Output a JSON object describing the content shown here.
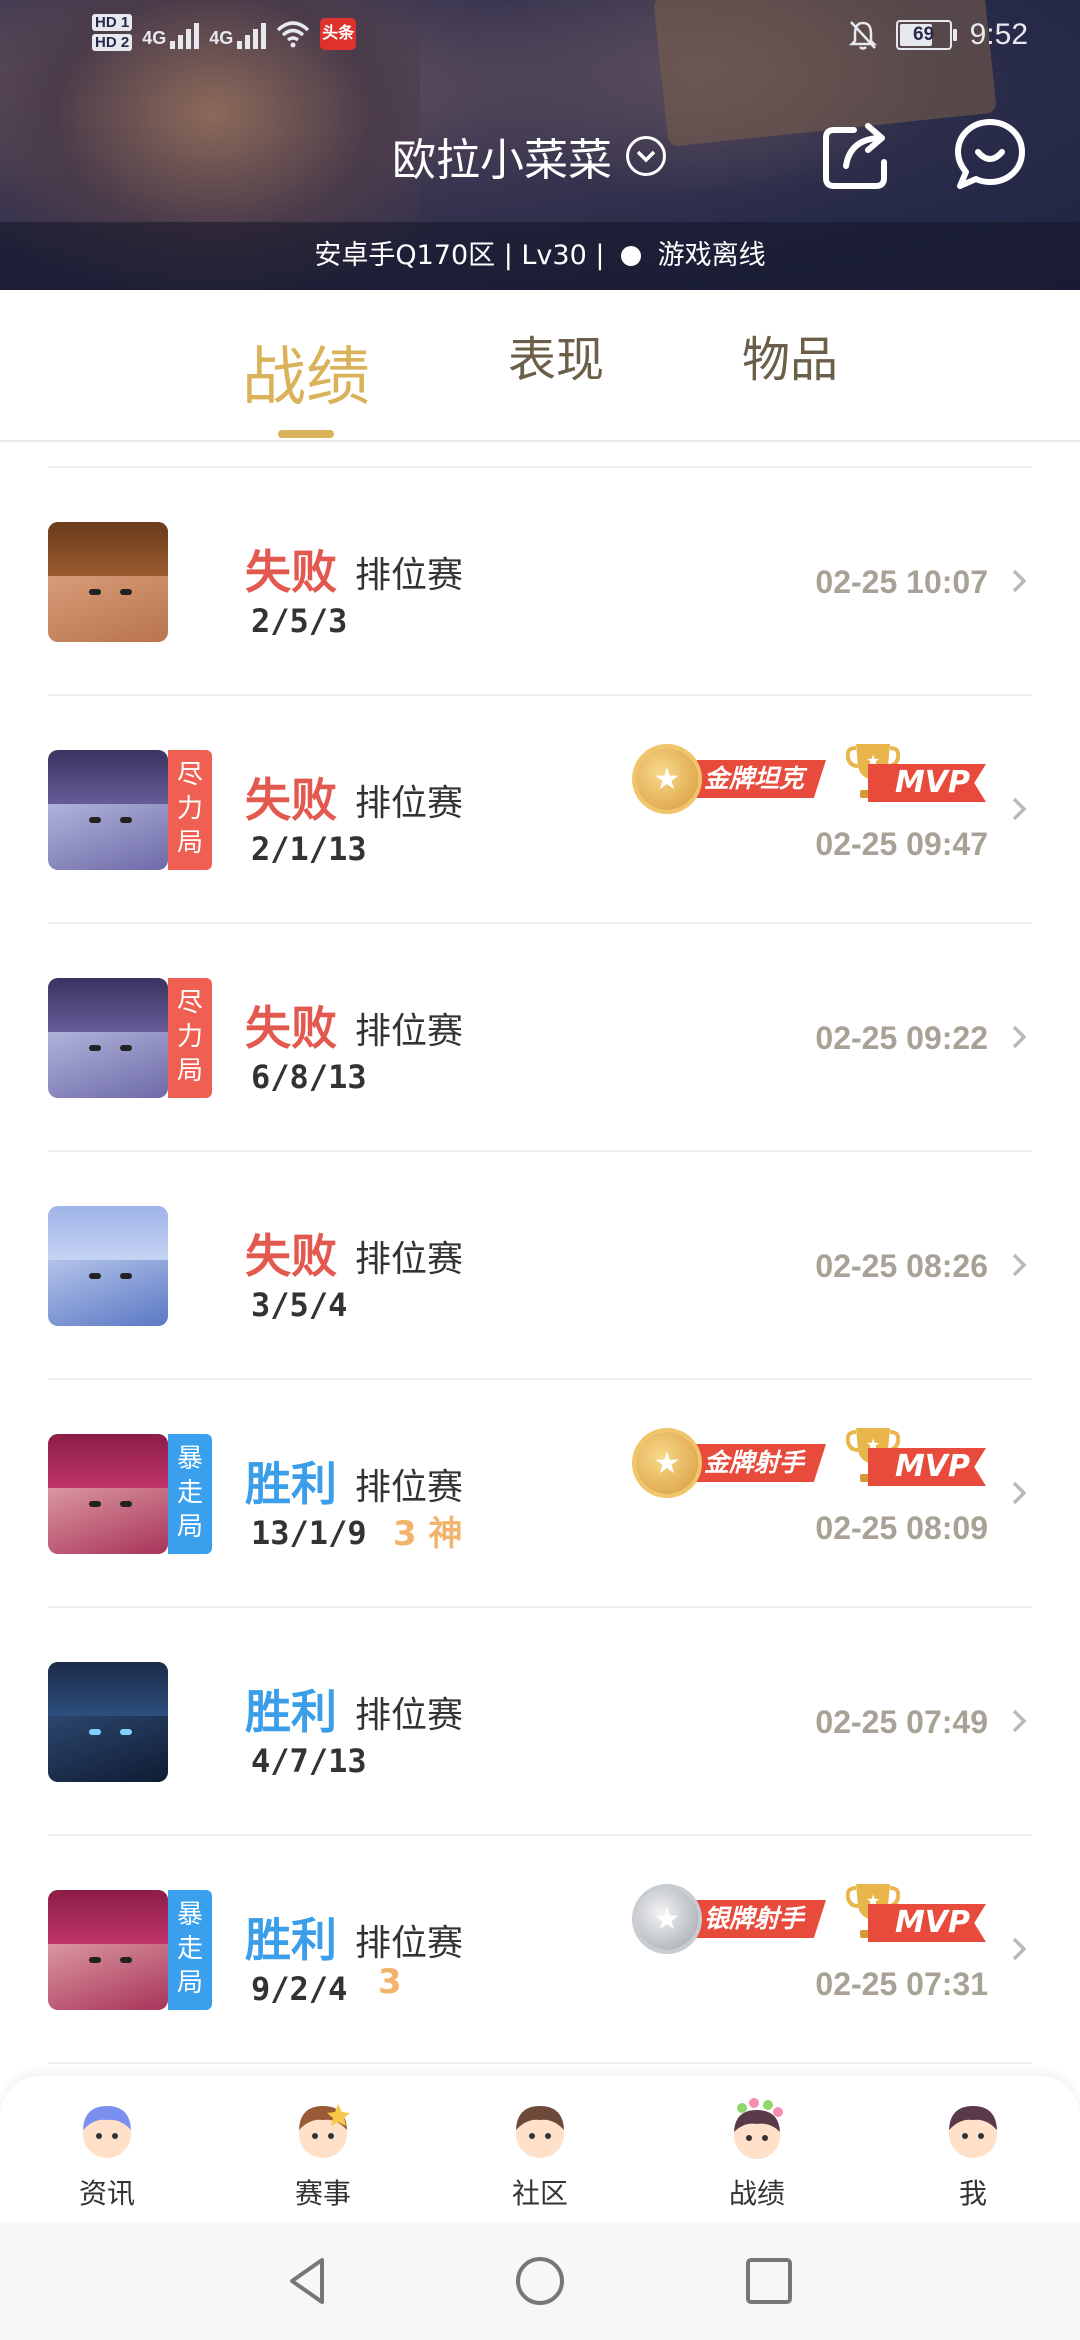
{
  "status_bar": {
    "hd1": "HD 1",
    "hd2": "HD 2",
    "net1": "4G",
    "net2": "4G",
    "app_icon_text": "头条",
    "battery": "69",
    "time": "9:52"
  },
  "header": {
    "username": "欧拉小菜菜",
    "subinfo_prefix": "安卓手Q170区 | Lv30 |",
    "status_text": "游戏离线",
    "share_icon": "share-icon",
    "chat_icon": "chat-icon"
  },
  "tabs": [
    {
      "label": "战绩",
      "active": true
    },
    {
      "label": "表现",
      "active": false
    },
    {
      "label": "物品",
      "active": false
    }
  ],
  "matches": [
    {
      "result": "失败",
      "outcome": "loss",
      "mode": "排位赛",
      "kda": "2/5/3",
      "time": "02-25 10:07",
      "tag": "",
      "badge": "",
      "mvp": false,
      "extra": ""
    },
    {
      "result": "失败",
      "outcome": "loss",
      "mode": "排位赛",
      "kda": "2/1/13",
      "time": "02-25 09:47",
      "tag": "尽力局",
      "badge": "金牌坦克",
      "badge_tier": "gold",
      "mvp": true,
      "mvp_text": "MVP",
      "extra": ""
    },
    {
      "result": "失败",
      "outcome": "loss",
      "mode": "排位赛",
      "kda": "6/8/13",
      "time": "02-25 09:22",
      "tag": "尽力局",
      "badge": "",
      "mvp": false,
      "extra": ""
    },
    {
      "result": "失败",
      "outcome": "loss",
      "mode": "排位赛",
      "kda": "3/5/4",
      "time": "02-25 08:26",
      "tag": "",
      "badge": "",
      "mvp": false,
      "extra": ""
    },
    {
      "result": "胜利",
      "outcome": "win",
      "mode": "排位赛",
      "kda": "13/1/9",
      "time": "02-25 08:09",
      "tag": "暴走局",
      "badge": "金牌射手",
      "badge_tier": "gold",
      "mvp": true,
      "mvp_text": "MVP",
      "extra": "3 神"
    },
    {
      "result": "胜利",
      "outcome": "win",
      "mode": "排位赛",
      "kda": "4/7/13",
      "time": "02-25 07:49",
      "tag": "",
      "badge": "",
      "mvp": false,
      "extra": ""
    },
    {
      "result": "胜利",
      "outcome": "win",
      "mode": "排位赛",
      "kda": "9/2/4",
      "time": "02-25 07:31",
      "tag": "暴走局",
      "badge": "银牌射手",
      "badge_tier": "silver",
      "mvp": true,
      "mvp_text": "MVP",
      "extra": "3"
    }
  ],
  "bottom_nav": [
    {
      "label": "资讯",
      "icon": "news-avatar-icon"
    },
    {
      "label": "赛事",
      "icon": "events-avatar-icon"
    },
    {
      "label": "社区",
      "icon": "community-avatar-icon"
    },
    {
      "label": "战绩",
      "icon": "record-avatar-icon"
    },
    {
      "label": "我",
      "icon": "me-avatar-icon"
    }
  ],
  "colors": {
    "accent_gold": "#d9b25a",
    "loss": "#e4594f",
    "win": "#3a9ee8",
    "tag_red": "#ef5f52",
    "tag_blue": "#3aa0ee"
  }
}
